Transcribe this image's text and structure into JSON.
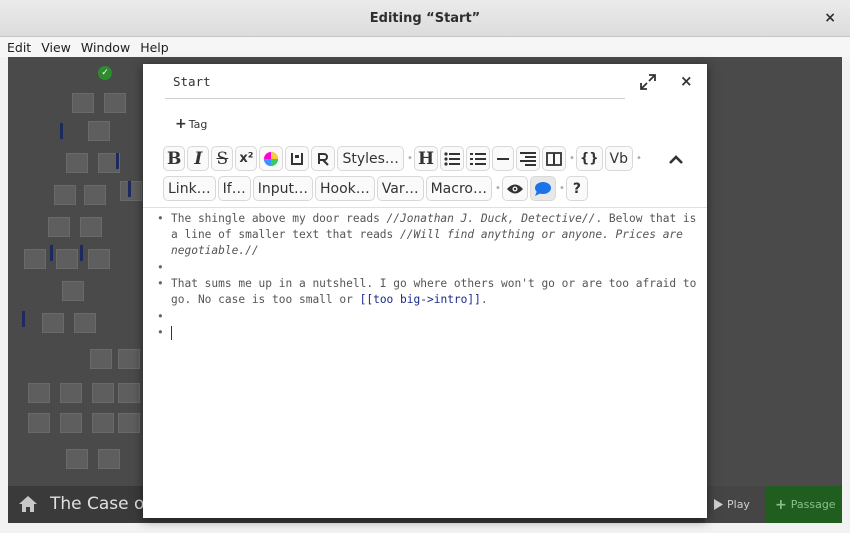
{
  "window": {
    "title": "Editing “Start”",
    "close": "×"
  },
  "menubar": {
    "items": [
      "Edit",
      "View",
      "Window",
      "Help"
    ]
  },
  "story": {
    "name": "The Case of"
  },
  "bottom": {
    "play": "Play",
    "passage": "Passage"
  },
  "dialog": {
    "passage_name": "Start",
    "close": "×",
    "tag_label": "Tag"
  },
  "toolbar": {
    "bold": "B",
    "italic": "I",
    "strike": "S",
    "super": "x²",
    "styles": "Styles…",
    "heading": "H",
    "code": "{}",
    "vb": "Vb",
    "link": "Link…",
    "if": "If…",
    "input": "Input…",
    "hook": "Hook…",
    "var": "Var…",
    "macro": "Macro…",
    "help": "?"
  },
  "editor": {
    "line1a": "The shingle above my door reads ",
    "line1b": "//Jonathan J. Duck, Detective//",
    "line1c": ". Below that is a line of smaller text that reads ",
    "line1d": "//Will find anything or anyone. Prices are negotiable.//",
    "line2": "That sums me up in a nutshell. I go where others won't go or are too afraid to go. No case is too small or ",
    "link_open": "[[",
    "link_text": "too big",
    "link_arrow": "->",
    "link_target": "intro",
    "link_close": "]]",
    "period": ".",
    "bullet": "•"
  },
  "colors": {
    "accent_green": "#1f5e1f",
    "link_blue": "#1a2a8a",
    "comment_blue": "#1a73e8"
  }
}
